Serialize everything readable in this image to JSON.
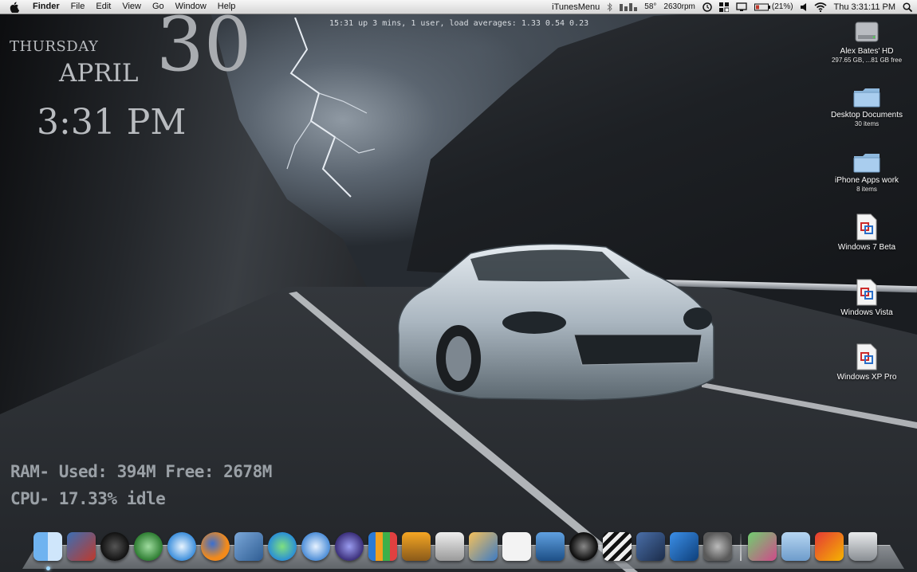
{
  "menubar": {
    "app_name": "Finder",
    "menus": [
      "File",
      "Edit",
      "View",
      "Go",
      "Window",
      "Help"
    ],
    "itunes_menu": "iTunesMenu",
    "temperature": "58°",
    "fan_speed": "2630rpm",
    "battery": "(21%)",
    "clock": "Thu 3:31:11 PM"
  },
  "clock_widget": {
    "day_name": "THURSDAY",
    "month": "APRIL",
    "day_number": "30",
    "time": "3:31 PM"
  },
  "uptime_line": "15:31  up 3 mins, 1 user, load averages: 1.33 0.54 0.23",
  "system_stats": {
    "ram_line": "RAM- Used: 394M Free: 2678M",
    "cpu_line": "CPU- 17.33% idle"
  },
  "desktop_icons": [
    {
      "name": "Alex Bates' HD",
      "info": "297.65 GB, ...81 GB free",
      "icon": "hard-drive-icon"
    },
    {
      "name": "Desktop Documents",
      "info": "30 items",
      "icon": "folder-icon"
    },
    {
      "name": "iPhone Apps work",
      "info": "8 items",
      "icon": "folder-icon"
    },
    {
      "name": "Windows 7 Beta",
      "info": "",
      "icon": "vm-document-icon"
    },
    {
      "name": "Windows Vista",
      "info": "",
      "icon": "vm-document-icon"
    },
    {
      "name": "Windows XP Pro",
      "info": "",
      "icon": "vm-document-icon"
    }
  ],
  "dock_items": [
    "finder-icon",
    "vmware-fusion-icon",
    "dashboard-icon",
    "time-machine-icon",
    "safari-icon",
    "firefox-icon",
    "preview-icon",
    "itunes-visualizer-icon",
    "itunes-icon",
    "pen-utility-icon",
    "activity-monitor-icon",
    "keynote-icon",
    "printer-icon",
    "iphoto-icon",
    "acrobat-icon",
    "photo-booth-icon",
    "aperture-icon",
    "final-cut-icon",
    "quicktime-icon",
    "iphone-simulator-icon",
    "system-preferences-icon",
    "applications-stack-icon",
    "documents-folder-icon",
    "downloads-stack-icon",
    "trash-icon"
  ],
  "colors": {
    "menubar": "#e6e6e6",
    "widget_text": "#b9bcc0",
    "stats_text": "#9aa0a6"
  }
}
